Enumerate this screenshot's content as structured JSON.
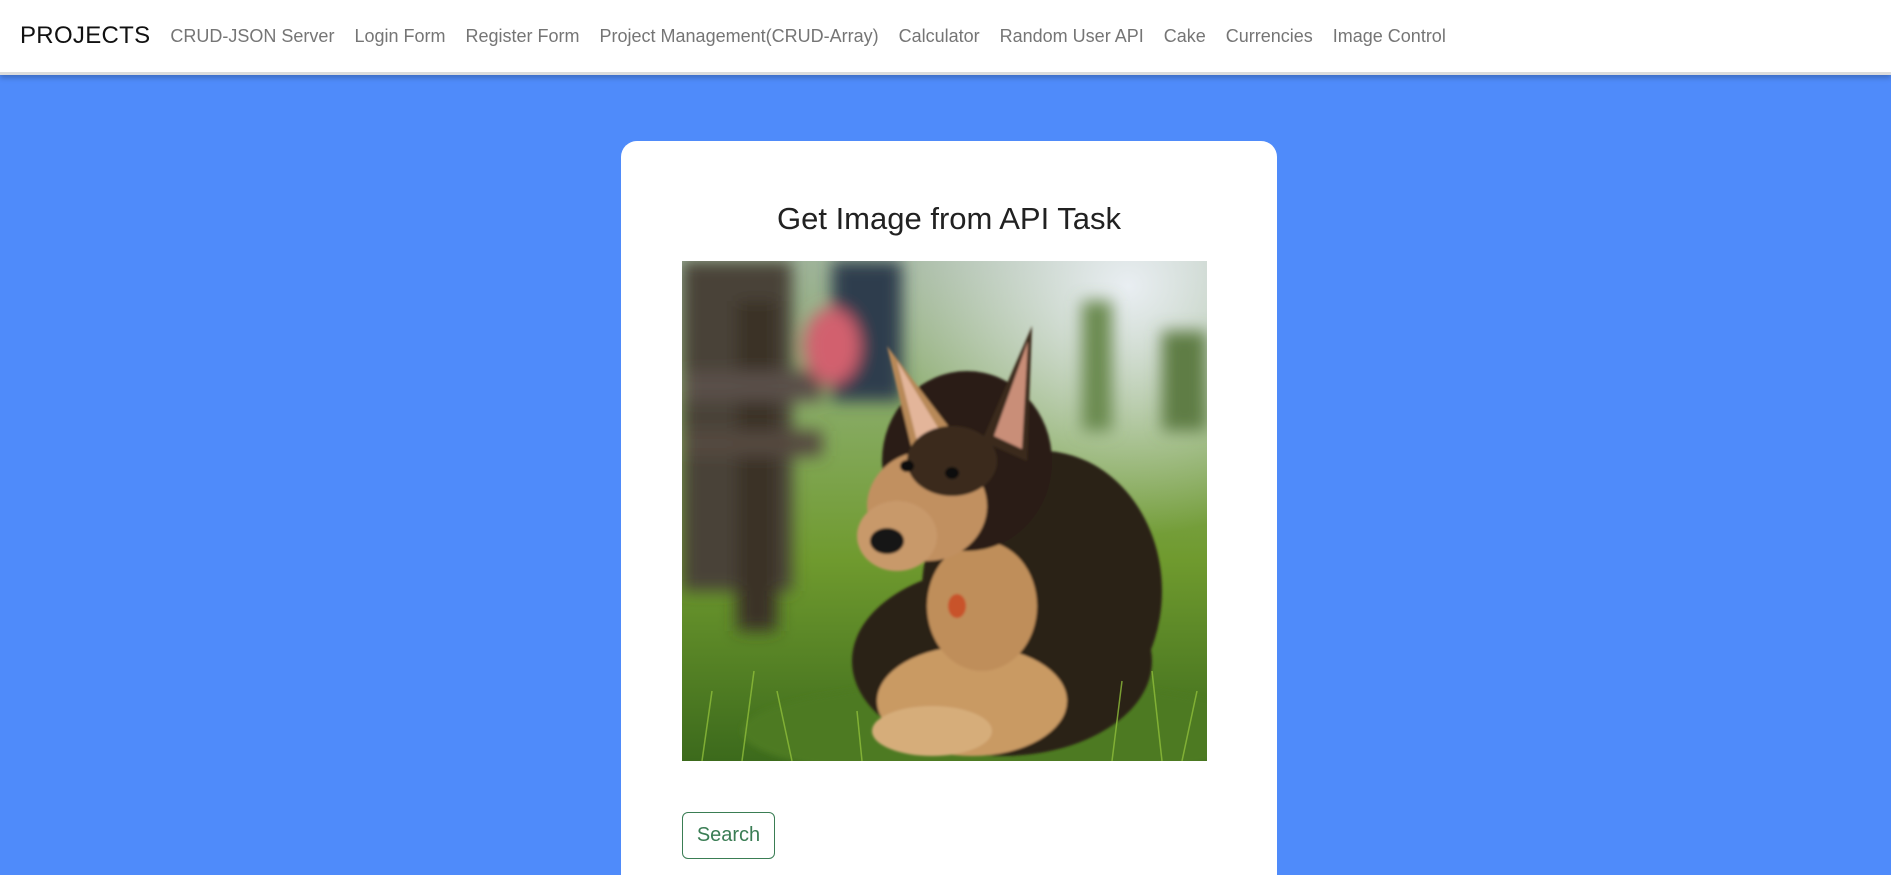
{
  "navbar": {
    "brand": "PROJECTS",
    "links": [
      {
        "label": "CRUD-JSON Server"
      },
      {
        "label": "Login Form"
      },
      {
        "label": "Register Form"
      },
      {
        "label": "Project Management(CRUD-Array)"
      },
      {
        "label": "Calculator"
      },
      {
        "label": "Random User API"
      },
      {
        "label": "Cake"
      },
      {
        "label": "Currencies"
      },
      {
        "label": "Image Control"
      }
    ]
  },
  "card": {
    "title": "Get Image from API Task",
    "image_subject": "german-shepherd-puppy-photo",
    "search_label": "Search"
  },
  "colors": {
    "page_background": "#4f8bfa",
    "navbar_background": "#ffffff",
    "nav_link": "#757575",
    "button_accent": "#3a7d54"
  }
}
